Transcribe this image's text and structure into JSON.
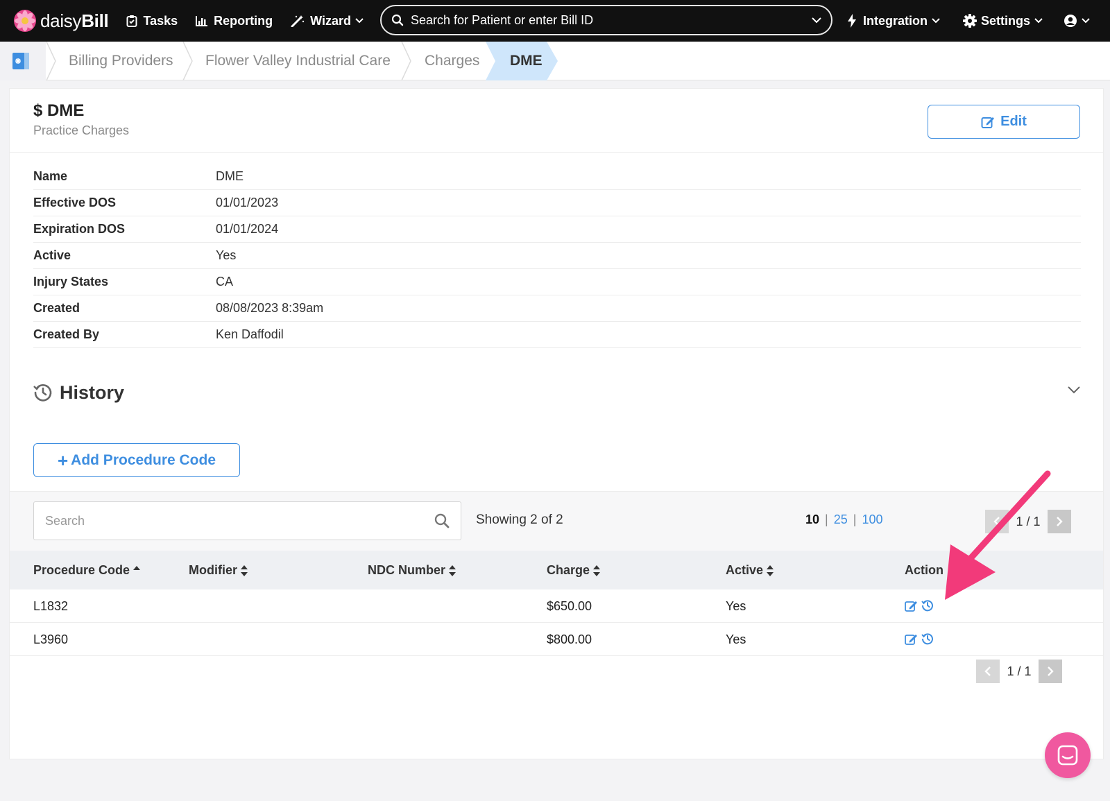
{
  "nav": {
    "brand_light": "daisy",
    "brand_bold": "Bill",
    "tasks": "Tasks",
    "reporting": "Reporting",
    "wizard": "Wizard",
    "search_placeholder": "Search for Patient or enter Bill ID",
    "integration": "Integration",
    "settings": "Settings",
    "icons": [
      "flower-logo-icon",
      "clipboard-icon",
      "bar-chart-icon",
      "magic-wand-icon",
      "search-icon",
      "lightning-icon",
      "gear-icon",
      "user-circle-icon",
      "chevron-down-icon"
    ]
  },
  "breadcrumb": {
    "items": [
      "Billing Providers",
      "Flower Valley Industrial Care",
      "Charges"
    ],
    "active": "DME"
  },
  "header": {
    "title": "$ DME",
    "subtitle": "Practice Charges",
    "edit_label": "Edit"
  },
  "details": [
    {
      "label": "Name",
      "value": "DME"
    },
    {
      "label": "Effective DOS",
      "value": "01/01/2023"
    },
    {
      "label": "Expiration DOS",
      "value": "01/01/2024"
    },
    {
      "label": "Active",
      "value": "Yes"
    },
    {
      "label": "Injury States",
      "value": "CA"
    },
    {
      "label": "Created",
      "value": "08/08/2023 8:39am"
    },
    {
      "label": "Created By",
      "value": "Ken Daffodil"
    }
  ],
  "history": {
    "title": "History"
  },
  "add_button": {
    "plus": "+",
    "label": "Add Procedure Code"
  },
  "table_toolbar": {
    "search_placeholder": "Search",
    "showing": "Showing 2 of 2",
    "page_sizes": {
      "current": "10",
      "options": [
        "25",
        "100"
      ],
      "separator": "|"
    },
    "page_text": "1 / 1"
  },
  "table": {
    "columns": [
      "Procedure Code",
      "Modifier",
      "NDC Number",
      "Charge",
      "Active",
      "Action"
    ],
    "rows": [
      {
        "code": "L1832",
        "modifier": "",
        "ndc": "",
        "charge": "$650.00",
        "active": "Yes"
      },
      {
        "code": "L3960",
        "modifier": "",
        "ndc": "",
        "charge": "$800.00",
        "active": "Yes"
      }
    ]
  },
  "colors": {
    "nav_bg": "#111111",
    "accent_blue": "#3e8ee0",
    "breadcrumb_active": "#cfe6fb",
    "annotation_arrow": "#f23a7a",
    "chat_button": "#f0589f"
  }
}
